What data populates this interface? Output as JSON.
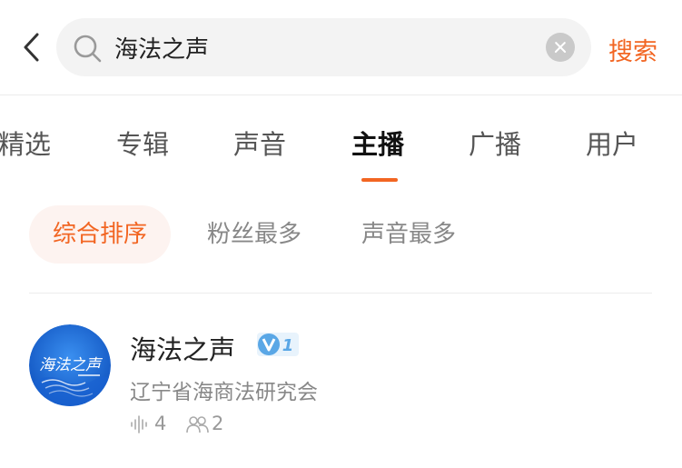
{
  "search": {
    "value": "海法之声",
    "placeholder": "",
    "submit_label": "搜索"
  },
  "tabs": [
    {
      "label": "精选",
      "active": false
    },
    {
      "label": "专辑",
      "active": false
    },
    {
      "label": "声音",
      "active": false
    },
    {
      "label": "主播",
      "active": true
    },
    {
      "label": "广播",
      "active": false
    },
    {
      "label": "用户",
      "active": false
    }
  ],
  "sort_options": [
    {
      "label": "综合排序",
      "active": true
    },
    {
      "label": "粉丝最多",
      "active": false
    },
    {
      "label": "声音最多",
      "active": false
    }
  ],
  "results": [
    {
      "name": "海法之声",
      "verify_level": "1",
      "description": "辽宁省海商法研究会",
      "sound_count": "4",
      "fans_count": "2",
      "avatar_text": "海法之声"
    }
  ],
  "colors": {
    "accent": "#f26522",
    "verify_blue": "#5aa7e6",
    "avatar_blue": "#1e6fd6"
  }
}
